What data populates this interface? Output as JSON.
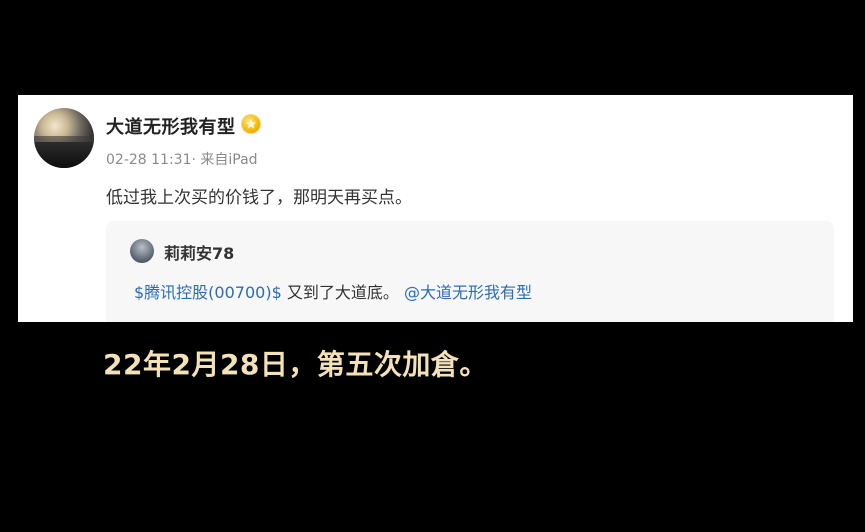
{
  "post": {
    "author": "大道无形我有型",
    "badge_icon": "gold-verified-badge-icon",
    "timestamp": "02-28 11:31",
    "source": "· 来自iPad",
    "text": "低过我上次买的价钱了，那明天再买点。"
  },
  "quoted": {
    "author": "莉莉安78",
    "stock_tag": "$腾讯控股(00700)$",
    "text": " 又到了大道底。",
    "mention": "@大道无形我有型"
  },
  "caption": "22年2月28日，第五次加倉。",
  "colors": {
    "background": "#000000",
    "card": "#ffffff",
    "quote_bg": "#f7f7f7",
    "link": "#2d6cb5",
    "caption": "#f3e2b8"
  }
}
